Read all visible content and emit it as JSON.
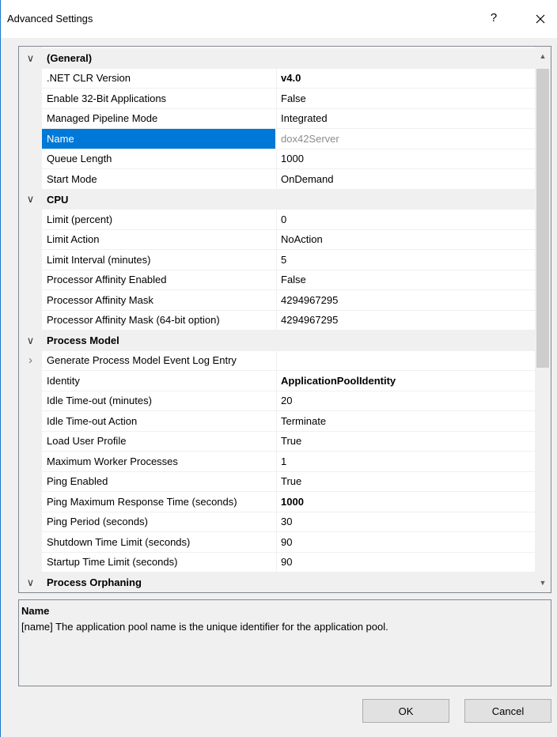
{
  "window": {
    "title": "Advanced Settings",
    "help_label": "?",
    "close_icon": "close-icon"
  },
  "grid": {
    "rows": [
      {
        "kind": "category",
        "expander": "chevron-down",
        "name": "(General)"
      },
      {
        "kind": "property",
        "name": ".NET CLR Version",
        "value": "v4.0",
        "bold": true
      },
      {
        "kind": "property",
        "name": "Enable 32-Bit Applications",
        "value": "False"
      },
      {
        "kind": "property",
        "name": "Managed Pipeline Mode",
        "value": "Integrated"
      },
      {
        "kind": "property",
        "name": "Name",
        "value": "dox42Server",
        "selected": true,
        "readonly": true
      },
      {
        "kind": "property",
        "name": "Queue Length",
        "value": "1000"
      },
      {
        "kind": "property",
        "name": "Start Mode",
        "value": "OnDemand"
      },
      {
        "kind": "category",
        "expander": "chevron-down",
        "name": "CPU"
      },
      {
        "kind": "property",
        "name": "Limit (percent)",
        "value": "0"
      },
      {
        "kind": "property",
        "name": "Limit Action",
        "value": "NoAction"
      },
      {
        "kind": "property",
        "name": "Limit Interval (minutes)",
        "value": "5"
      },
      {
        "kind": "property",
        "name": "Processor Affinity Enabled",
        "value": "False"
      },
      {
        "kind": "property",
        "name": "Processor Affinity Mask",
        "value": "4294967295"
      },
      {
        "kind": "property",
        "name": "Processor Affinity Mask (64-bit option)",
        "value": "4294967295"
      },
      {
        "kind": "category",
        "expander": "chevron-down",
        "name": "Process Model"
      },
      {
        "kind": "property",
        "name": "Generate Process Model Event Log Entry",
        "value": "",
        "expander": "chevron-right"
      },
      {
        "kind": "property",
        "name": "Identity",
        "value": "ApplicationPoolIdentity",
        "bold": true
      },
      {
        "kind": "property",
        "name": "Idle Time-out (minutes)",
        "value": "20"
      },
      {
        "kind": "property",
        "name": "Idle Time-out Action",
        "value": "Terminate"
      },
      {
        "kind": "property",
        "name": "Load User Profile",
        "value": "True"
      },
      {
        "kind": "property",
        "name": "Maximum Worker Processes",
        "value": "1"
      },
      {
        "kind": "property",
        "name": "Ping Enabled",
        "value": "True"
      },
      {
        "kind": "property",
        "name": "Ping Maximum Response Time (seconds)",
        "value": "1000",
        "bold": true
      },
      {
        "kind": "property",
        "name": "Ping Period (seconds)",
        "value": "30"
      },
      {
        "kind": "property",
        "name": "Shutdown Time Limit (seconds)",
        "value": "90"
      },
      {
        "kind": "property",
        "name": "Startup Time Limit (seconds)",
        "value": "90"
      },
      {
        "kind": "category",
        "expander": "chevron-down",
        "name": "Process Orphaning"
      }
    ]
  },
  "description": {
    "title": "Name",
    "text": "[name] The application pool name is the unique identifier for the application pool."
  },
  "buttons": {
    "ok_label": "OK",
    "cancel_label": "Cancel"
  },
  "colors": {
    "selection": "#0078d7",
    "window_border": "#1979ca",
    "category_bg": "#f0f0f0"
  }
}
